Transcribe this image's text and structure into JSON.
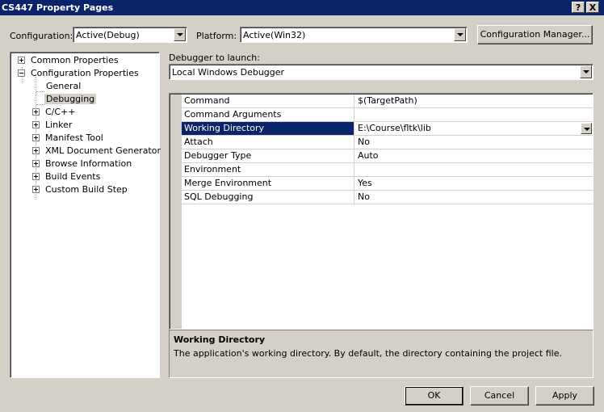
{
  "window": {
    "title": "CS447 Property Pages",
    "help_button": "?",
    "close_button": "X"
  },
  "config_bar": {
    "configuration_label": "Configuration:",
    "configuration_value": "Active(Debug)",
    "platform_label": "Platform:",
    "platform_value": "Active(Win32)",
    "manager_button": "Configuration Manager..."
  },
  "tree": {
    "nodes": [
      {
        "label": "Common Properties",
        "expander": "plus"
      },
      {
        "label": "Configuration Properties",
        "expander": "minus"
      },
      {
        "label": "General"
      },
      {
        "label": "Debugging",
        "selected": true
      },
      {
        "label": "C/C++",
        "expander": "plus"
      },
      {
        "label": "Linker",
        "expander": "plus"
      },
      {
        "label": "Manifest Tool",
        "expander": "plus"
      },
      {
        "label": "XML Document Generator",
        "expander": "plus"
      },
      {
        "label": "Browse Information",
        "expander": "plus"
      },
      {
        "label": "Build Events",
        "expander": "plus"
      },
      {
        "label": "Custom Build Step",
        "expander": "plus"
      }
    ]
  },
  "debugger": {
    "label": "Debugger to launch:",
    "value": "Local Windows Debugger"
  },
  "properties": {
    "rows": [
      {
        "name": "Command",
        "value": "$(TargetPath)"
      },
      {
        "name": "Command Arguments",
        "value": ""
      },
      {
        "name": "Working Directory",
        "value": "E:\\Course\\fltk\\lib",
        "selected": true
      },
      {
        "name": "Attach",
        "value": "No"
      },
      {
        "name": "Debugger Type",
        "value": "Auto"
      },
      {
        "name": "Environment",
        "value": ""
      },
      {
        "name": "Merge Environment",
        "value": "Yes"
      },
      {
        "name": "SQL Debugging",
        "value": "No"
      }
    ]
  },
  "description": {
    "title": "Working Directory",
    "text": "The application's working directory.  By default, the directory containing the project file."
  },
  "buttons": {
    "ok": "OK",
    "cancel": "Cancel",
    "apply": "Apply"
  },
  "colors": {
    "dialog_bg": "#d4d0c8",
    "titlebar": "#0a246a",
    "selection": "#0a246a"
  }
}
